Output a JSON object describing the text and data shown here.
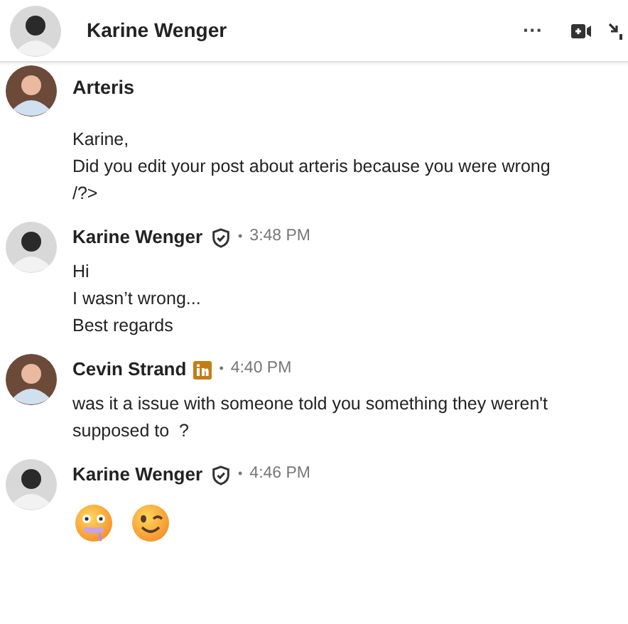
{
  "header": {
    "name": "Karine Wenger",
    "more": "···"
  },
  "messages": [
    {
      "avatar": {
        "kind": "man"
      },
      "kind": "text",
      "paragraphs": [
        {
          "text": "Arteris",
          "bold": true
        },
        {
          "text": "Karine,\nDid you edit your post about arteris because you were wrong /?>",
          "bold": false
        }
      ]
    },
    {
      "avatar": {
        "kind": "woman"
      },
      "sender": "Karine Wenger",
      "badge": {
        "kind": "verified"
      },
      "separator": "•",
      "time": "3:48 PM",
      "kind": "text",
      "paragraphs": [
        {
          "text": "Hi\nI wasn’t wrong...\nBest regards",
          "bold": false
        }
      ]
    },
    {
      "avatar": {
        "kind": "man"
      },
      "sender": "Cevin Strand",
      "badge": {
        "kind": "premium"
      },
      "separator": "•",
      "time": "4:40 PM",
      "kind": "text",
      "paragraphs": [
        {
          "text": "was it a issue with someone told you something they weren't supposed to  ?",
          "bold": false
        }
      ]
    },
    {
      "avatar": {
        "kind": "woman"
      },
      "sender": "Karine Wenger",
      "badge": {
        "kind": "verified"
      },
      "separator": "•",
      "time": "4:46 PM",
      "kind": "emoji",
      "emojis": [
        {
          "kind": "drooling"
        },
        {
          "kind": "wink"
        }
      ]
    }
  ]
}
